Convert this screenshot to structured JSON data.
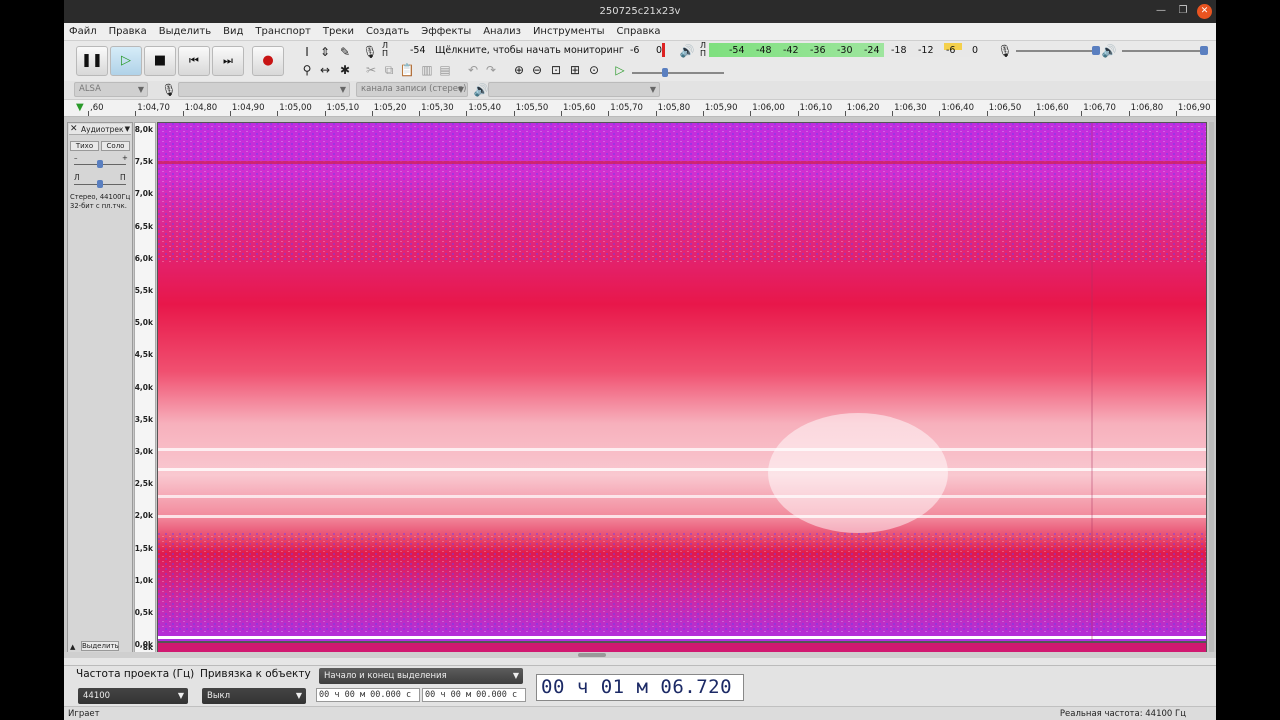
{
  "window": {
    "title": "250725c21x23v"
  },
  "menu": [
    "Файл",
    "Правка",
    "Выделить",
    "Вид",
    "Транспорт",
    "Треки",
    "Создать",
    "Эффекты",
    "Анализ",
    "Инструменты",
    "Справка"
  ],
  "meters": {
    "record_db": "-54",
    "record_hint": "Щёлкните, чтобы начать мониторинг",
    "record_scale": [
      "-6",
      "0"
    ],
    "lr_rec": [
      "Л",
      "П"
    ],
    "lr_play": [
      "Л",
      "П"
    ],
    "play_scale": [
      "-54",
      "-48",
      "-42",
      "-36",
      "-30",
      "-24",
      "-18",
      "-12",
      "-6",
      "0"
    ]
  },
  "device": {
    "host": "ALSA",
    "channels": "канала записи (стерео)"
  },
  "ruler": {
    "ticks": [
      ",60",
      "1:04,70",
      "1:04,80",
      "1:04,90",
      "1:05,00",
      "1:05,10",
      "1:05,20",
      "1:05,30",
      "1:05,40",
      "1:05,50",
      "1:05,60",
      "1:05,70",
      "1:05,80",
      "1:05,90",
      "1:06,00",
      "1:06,10",
      "1:06,20",
      "1:06,30",
      "1:06,40",
      "1:06,50",
      "1:06,60",
      "1:06,70",
      "1:06,80",
      "1:06,90"
    ]
  },
  "track": {
    "name": "Аудиотрек",
    "mute": "Тихо",
    "solo": "Соло",
    "gain_minus": "–",
    "gain_plus": "+",
    "pan_left": "Л",
    "pan_right": "П",
    "info_line1": "Стерео, 44100Гц",
    "info_line2": "32-бит с пл.тчк.",
    "select": "Выделить",
    "vticks": [
      "8,0k",
      "7,5k",
      "7,0k",
      "6,5k",
      "6,0k",
      "5,5k",
      "5,0k",
      "4,5k",
      "4,0k",
      "3,5k",
      "3,0k",
      "2,5k",
      "2,0k",
      "1,5k",
      "1,0k",
      "0,5k",
      "0,0k",
      "8k"
    ]
  },
  "selection": {
    "rate_label": "Частота проекта (Гц)",
    "rate_value": "44100",
    "snap_label": "Привязка к объекту",
    "snap_value": "Выкл",
    "mode": "Начало и конец выделения",
    "start": "00 ч 00 м 00.000 с",
    "end": "00 ч 00 м 00.000 с",
    "position": "00 ч 01 м 06.720 с"
  },
  "status": {
    "state": "Играет",
    "rate": "Реальная частота: 44100 Гц"
  },
  "colors": {
    "spectro_low": "#7b2fe0",
    "spectro_mid": "#e8174a",
    "spectro_high": "#ffffff",
    "meter_green": "#7fe07f",
    "time_text": "#1c2a66"
  }
}
